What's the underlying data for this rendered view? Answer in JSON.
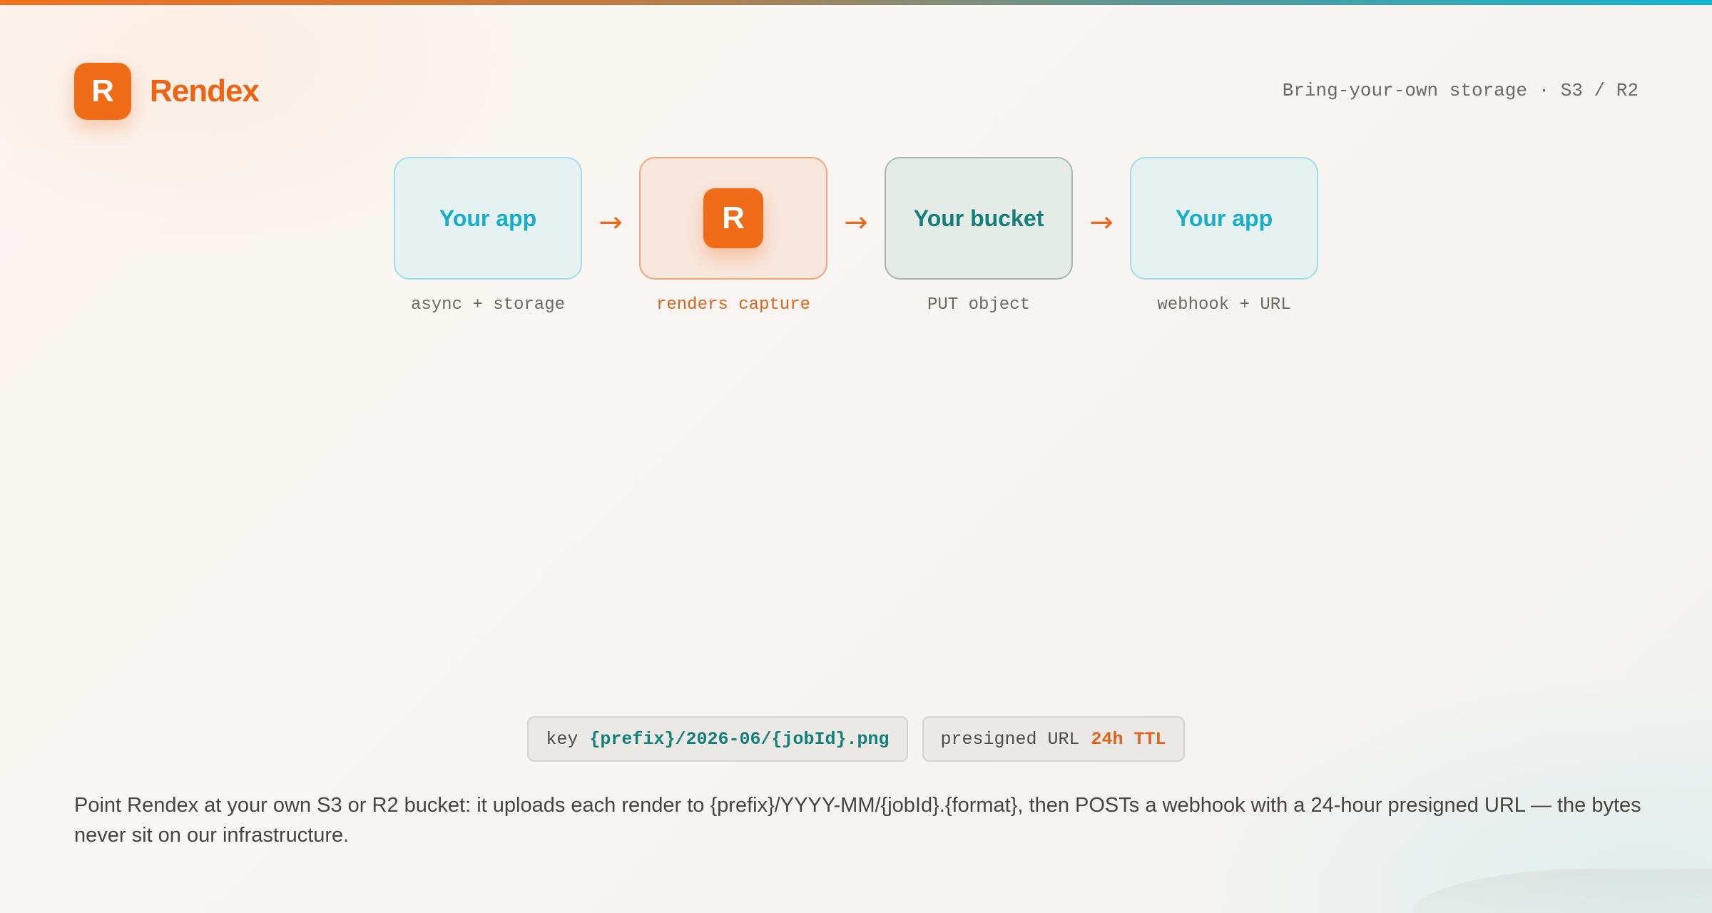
{
  "brand": {
    "mark": "R",
    "name": "Rendex"
  },
  "tagline": "Bring-your-own storage · S3 / R2",
  "flow": {
    "arrow": "→",
    "stages": [
      {
        "label": "Your app",
        "caption": "async + storage"
      },
      {
        "label": "R",
        "caption": "renders capture"
      },
      {
        "label": "Your bucket",
        "caption": "PUT object"
      },
      {
        "label": "Your app",
        "caption": "webhook + URL"
      }
    ]
  },
  "chips": [
    {
      "prefix": "key",
      "value": "{prefix}/2026-06/{jobId}.png"
    },
    {
      "prefix": "presigned URL",
      "value": "24h TTL"
    }
  ],
  "description": "Point Rendex at your own S3 or R2 bucket: it uploads each render to {prefix}/YYYY-MM/{jobId}.{format}, then POSTs a webhook with a 24-hour presigned URL — the bytes never sit on our infrastructure.",
  "colors": {
    "brand_orange": "#f06b17",
    "teal": "#147f78",
    "cyan": "#17aec9"
  }
}
